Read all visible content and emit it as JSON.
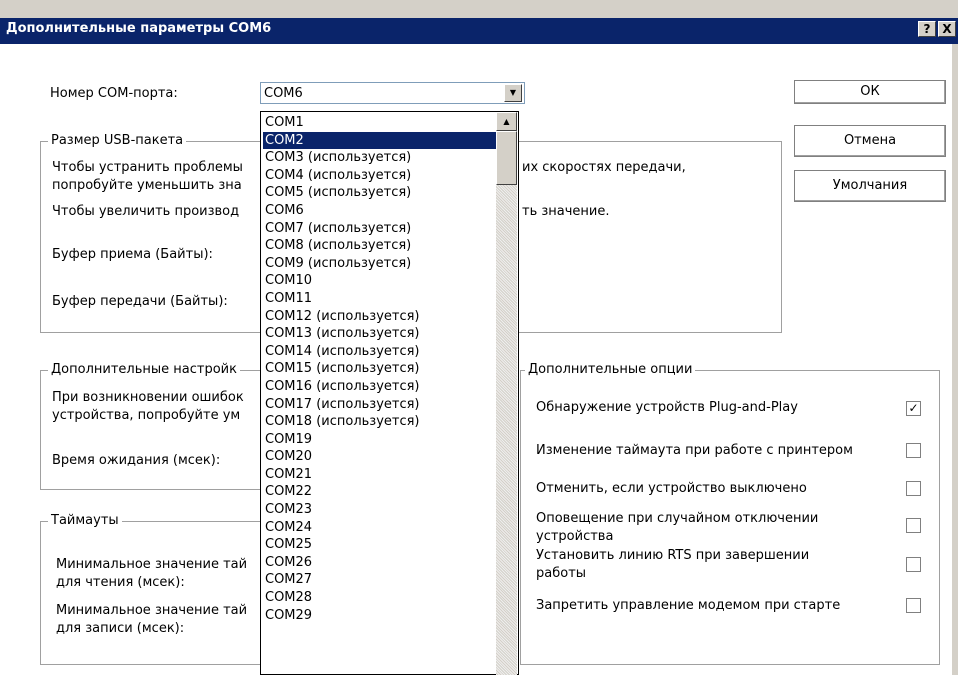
{
  "window": {
    "title": "Дополнительные параметры COM6",
    "help_button": "?",
    "close_button": "X"
  },
  "port": {
    "label": "Номер COM-порта:",
    "selected": "COM6",
    "options": [
      "COM1",
      "COM2",
      "COM3 (используется)",
      "COM4 (используется)",
      "COM5 (используется)",
      "COM6",
      "COM7 (используется)",
      "COM8 (используется)",
      "COM9 (используется)",
      "COM10",
      "COM11",
      "COM12 (используется)",
      "COM13 (используется)",
      "COM14 (используется)",
      "COM15 (используется)",
      "COM16 (используется)",
      "COM17 (используется)",
      "COM18 (используется)",
      "COM19",
      "COM20",
      "COM21",
      "COM22",
      "COM23",
      "COM24",
      "COM25",
      "COM26",
      "COM27",
      "COM28",
      "COM29"
    ],
    "highlighted": "COM2"
  },
  "buttons": {
    "ok": "ОК",
    "cancel": "Отмена",
    "defaults": "Умолчания"
  },
  "usb_group": {
    "legend": "Размер USB-пакета",
    "line1_left": "Чтобы устранить проблемы",
    "line1_right": "их скоростях передачи,",
    "line2_left": "попробуйте уменьшить зна",
    "line3_left": "Чтобы увеличить производ",
    "line3_right": "ть значение.",
    "rx_label": "Буфер приема (Байты):",
    "tx_label": "Буфер передачи (Байты):"
  },
  "extra_settings": {
    "legend": "Дополнительные настройк",
    "line1": "При возникновении ошибок",
    "line2": "устройства, попробуйте ум",
    "timeout_label": "Время ожидания (мсек):"
  },
  "timeouts": {
    "legend": "Таймауты",
    "read_line1": "Минимальное значение тай",
    "read_line2": "для чтения (мсек):",
    "write_line1": "Минимальное значение тай",
    "write_line2": "для записи (мсек):"
  },
  "options": {
    "legend": "Дополнительные опции",
    "items": [
      {
        "line1": "Обнаружение устройств Plug-and-Play",
        "line2": "",
        "checked": true
      },
      {
        "line1": "Изменение таймаута при работе с принтером",
        "line2": "",
        "checked": false
      },
      {
        "line1": "Отменить, если устройство выключено",
        "line2": "",
        "checked": false
      },
      {
        "line1": "Оповещение при случайном отключении",
        "line2": "устройства",
        "checked": false
      },
      {
        "line1": "Установить линию RTS при завершении",
        "line2": "работы",
        "checked": false
      },
      {
        "line1": "Запретить управление модемом при старте",
        "line2": "",
        "checked": false
      }
    ],
    "check_mark": "✓"
  },
  "colors": {
    "titlebar": "#0a246a",
    "selection": "#0a246a"
  }
}
